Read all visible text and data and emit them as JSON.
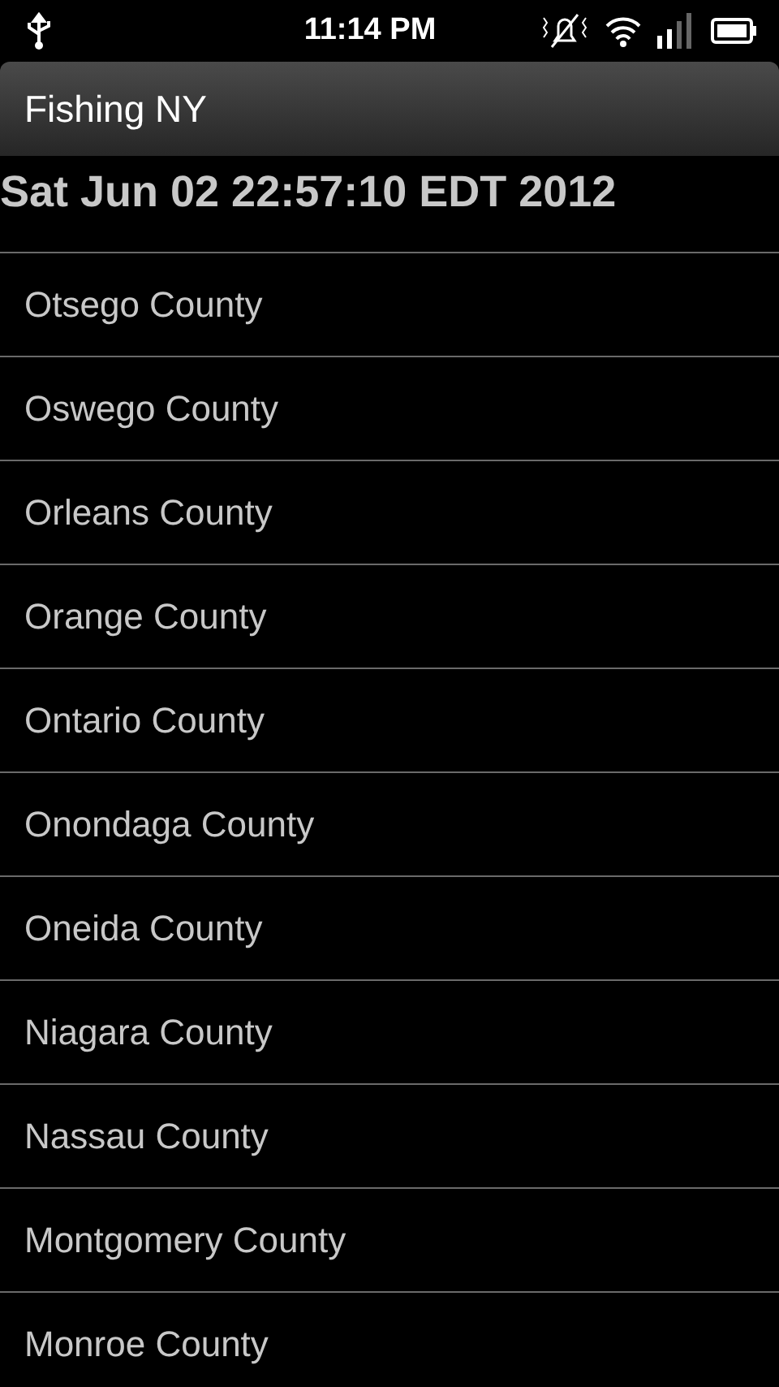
{
  "status_bar": {
    "time": "11:14 PM"
  },
  "title_bar": {
    "title": "Fishing NY"
  },
  "header": {
    "text": "Sat Jun 02 22:57:10 EDT 2012"
  },
  "list": [
    {
      "label": "Otsego County"
    },
    {
      "label": "Oswego County"
    },
    {
      "label": "Orleans County"
    },
    {
      "label": "Orange County"
    },
    {
      "label": "Ontario County"
    },
    {
      "label": "Onondaga County"
    },
    {
      "label": "Oneida County"
    },
    {
      "label": "Niagara County"
    },
    {
      "label": "Nassau County"
    },
    {
      "label": "Montgomery County"
    },
    {
      "label": "Monroe County"
    }
  ]
}
